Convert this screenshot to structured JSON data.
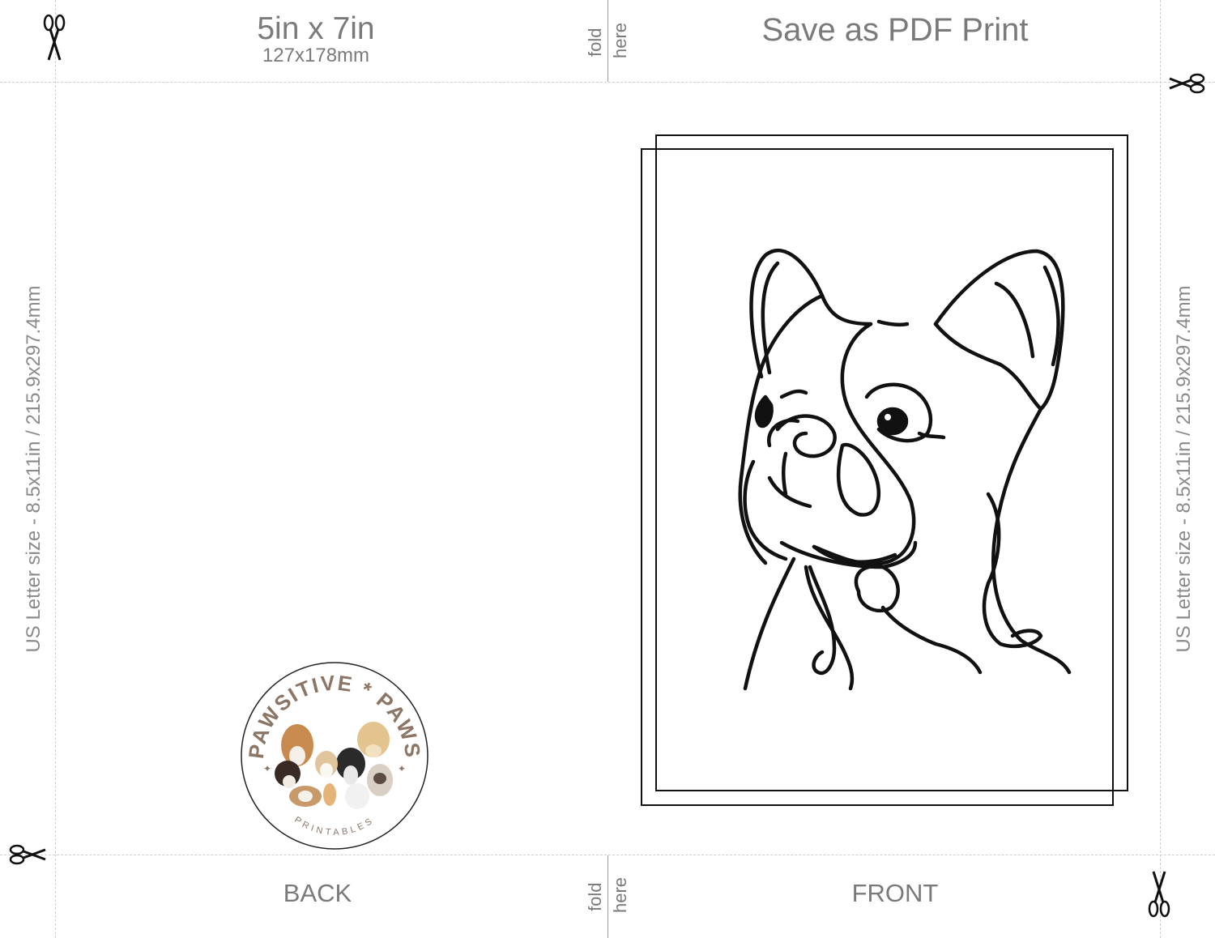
{
  "header": {
    "size_label": "5in x 7in",
    "size_mm": "127x178mm",
    "fold_word1": "fold",
    "fold_word2": "here",
    "print_note": "Save as PDF Print"
  },
  "footer": {
    "back_label": "BACK",
    "front_label": "FRONT",
    "fold_word1": "fold",
    "fold_word2": "here"
  },
  "sides": {
    "left": "US Letter size - 8.5x11in / 215.9x297.4mm",
    "right": "US Letter size - 8.5x11in / 215.9x297.4mm"
  },
  "logo": {
    "arc_text": "PAWSITIVE * PAWS",
    "bottom_text": "PRINTABLES"
  },
  "colors": {
    "guide": "#cfcfcf",
    "text": "#7a7a7a",
    "line_art": "#111111",
    "logo_brown": "#8b7565"
  },
  "icons": [
    "scissors-icon",
    "french-bulldog-line-art",
    "pawsitive-paws-logo"
  ]
}
